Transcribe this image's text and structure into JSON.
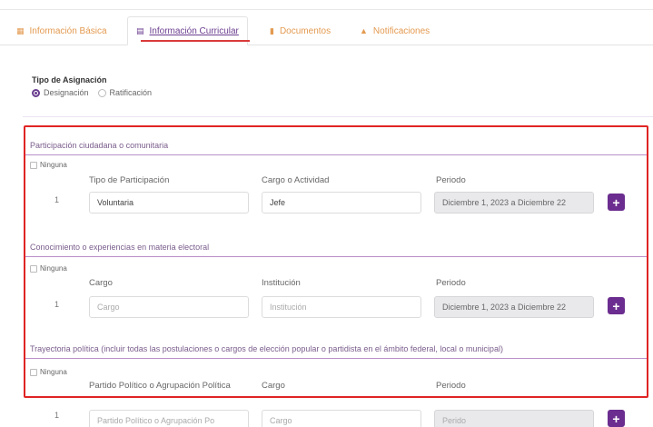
{
  "tabs": [
    {
      "icon": "id-card-icon",
      "glyph": "▦",
      "label": "Información Básica"
    },
    {
      "icon": "document-list-icon",
      "glyph": "▤",
      "label": "Información Curricular"
    },
    {
      "icon": "file-icon",
      "glyph": "▮",
      "label": "Documentos"
    },
    {
      "icon": "bell-icon",
      "glyph": "▲",
      "label": "Notificaciones"
    }
  ],
  "active_tab": "Información Curricular",
  "asignacion": {
    "title": "Tipo de Asignación",
    "options": [
      {
        "label": "Designación",
        "selected": true
      },
      {
        "label": "Ratificación",
        "selected": false
      }
    ]
  },
  "sections": [
    {
      "title": "Participación ciudadana o comunitaria",
      "ninguna": "Ninguna",
      "columns": [
        "Tipo de Participación",
        "Cargo o Actividad",
        "Periodo"
      ],
      "row": {
        "num": "1",
        "c1": "Voluntaria",
        "c2": "Jefe",
        "c3": "Diciembre 1, 2023 a Diciembre 22"
      }
    },
    {
      "title": "Conocimiento o experiencias en materia electoral",
      "ninguna": "Ninguna",
      "columns": [
        "Cargo",
        "Institución",
        "Periodo"
      ],
      "row": {
        "num": "1",
        "c1": "Cargo",
        "c2": "Institución",
        "c3": "Diciembre 1, 2023 a Diciembre 22"
      }
    },
    {
      "title": "Trayectoria política (incluir todas las postulaciones o cargos de elección popular o partidista en el ámbito federal, local o municipal)",
      "ninguna": "Ninguna",
      "columns": [
        "Partido Político o Agrupación Política",
        "Cargo",
        "Periodo"
      ],
      "row": {
        "num": "1",
        "c1": "Partido Político o Agrupación Po",
        "c2": "Cargo",
        "c3": "Perido"
      }
    }
  ],
  "add_button": "+",
  "colors": {
    "accent": "#6b2d8f",
    "tab_inactive": "#e39a50",
    "highlight": "#e02424"
  }
}
